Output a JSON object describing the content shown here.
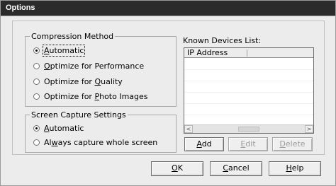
{
  "window": {
    "title": "Options"
  },
  "compression": {
    "legend": "Compression Method",
    "options": [
      {
        "pre": "",
        "key": "A",
        "post": "utomatic",
        "selected": true
      },
      {
        "pre": "",
        "key": "O",
        "post": "ptimize for Performance",
        "selected": false
      },
      {
        "pre": "Optimize for ",
        "key": "Q",
        "post": "uality",
        "selected": false
      },
      {
        "pre": "Optimize for ",
        "key": "P",
        "post": "hoto Images",
        "selected": false
      }
    ]
  },
  "capture": {
    "legend": "Screen Capture Settings",
    "options": [
      {
        "pre": "",
        "key": "A",
        "post": "utomatic",
        "selected": true
      },
      {
        "pre": "Al",
        "key": "w",
        "post": "ays capture whole screen",
        "selected": false
      }
    ]
  },
  "devices": {
    "label": "Known Devices List:",
    "column": "IP Address",
    "scroll_left": "<",
    "scroll_right": ">",
    "scroll_thumb": "III",
    "buttons": {
      "add": {
        "pre": "",
        "key": "A",
        "post": "dd"
      },
      "edit": {
        "pre": "",
        "key": "E",
        "post": "dit"
      },
      "delete": {
        "pre": "",
        "key": "D",
        "post": "elete"
      }
    }
  },
  "footer": {
    "ok": {
      "pre": "",
      "key": "O",
      "post": "K"
    },
    "cancel": {
      "pre": "",
      "key": "C",
      "post": "ancel"
    },
    "help": {
      "pre": "",
      "key": "H",
      "post": "elp"
    }
  }
}
